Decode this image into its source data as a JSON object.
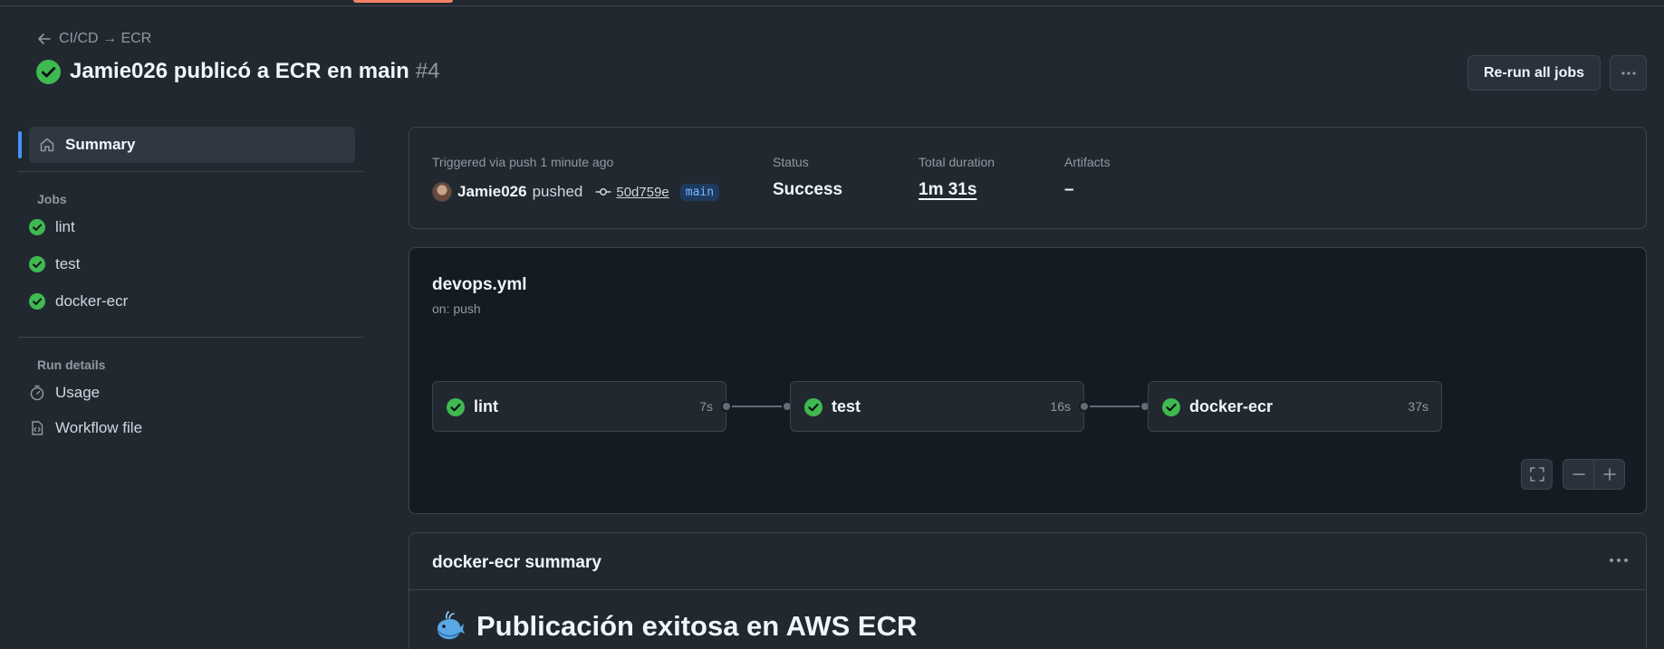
{
  "breadcrumb": {
    "back_label": "CI/CD → ECR"
  },
  "run": {
    "title": "Jamie026 publicó a ECR en main",
    "number": "#4"
  },
  "actions": {
    "rerun_label": "Re-run all jobs"
  },
  "sidebar": {
    "summary_label": "Summary",
    "jobs_heading": "Jobs",
    "jobs": [
      {
        "label": "lint"
      },
      {
        "label": "test"
      },
      {
        "label": "docker-ecr"
      }
    ],
    "run_details_heading": "Run details",
    "usage_label": "Usage",
    "workflow_file_label": "Workflow file"
  },
  "info": {
    "triggered_label": "Triggered via push 1 minute ago",
    "user": "Jamie026",
    "pushed_text": "pushed",
    "commit": "50d759e",
    "branch": "main",
    "status_label": "Status",
    "status_value": "Success",
    "duration_label": "Total duration",
    "duration_value": "1m 31s",
    "artifacts_label": "Artifacts",
    "artifacts_value": "–"
  },
  "workflow": {
    "file": "devops.yml",
    "trigger": "on: push",
    "jobs": [
      {
        "name": "lint",
        "time": "7s"
      },
      {
        "name": "test",
        "time": "16s"
      },
      {
        "name": "docker-ecr",
        "time": "37s"
      }
    ]
  },
  "job_summary": {
    "title": "docker-ecr summary",
    "heading": "Publicación exitosa en AWS ECR"
  },
  "colors": {
    "success": "#3fb950",
    "accent": "#4493f8",
    "tab_underline": "#f78166"
  },
  "icons": {
    "back": "arrow-left-icon",
    "status": "check-circle-fill-icon",
    "summary": "home-icon",
    "usage": "stopwatch-icon",
    "workflow_file": "file-code-icon",
    "commit": "git-commit-icon",
    "more": "kebab-horizontal-icon",
    "fullscreen": "screen-full-icon",
    "zoom_out": "dash-icon",
    "zoom_in": "plus-icon",
    "whale": "whale-emoji"
  }
}
